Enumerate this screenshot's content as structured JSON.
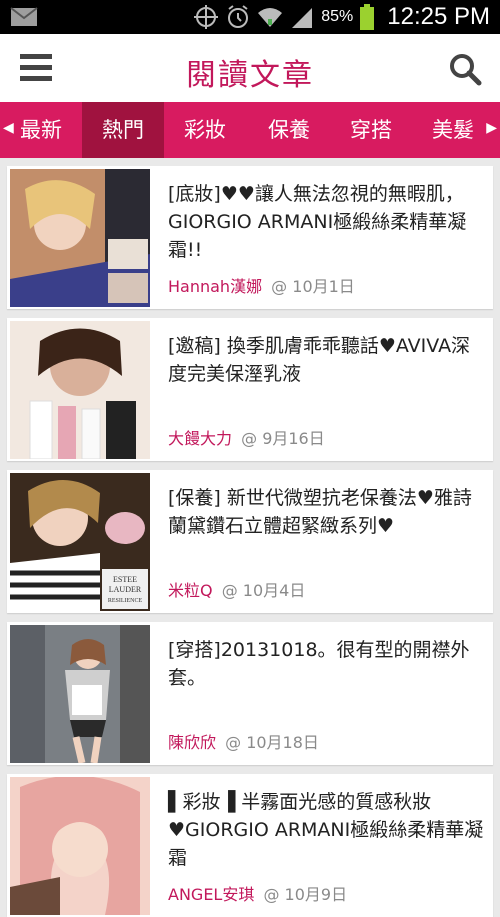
{
  "status_bar": {
    "battery_percent": "85%",
    "time": "12:25 PM"
  },
  "header": {
    "title": "閱讀文章"
  },
  "tabs": [
    {
      "label": "最新",
      "active": false
    },
    {
      "label": "熱門",
      "active": true
    },
    {
      "label": "彩妝",
      "active": false
    },
    {
      "label": "保養",
      "active": false
    },
    {
      "label": "穿搭",
      "active": false
    },
    {
      "label": "美髮",
      "active": false
    }
  ],
  "articles": [
    {
      "title": "[底妝]♥♥讓人無法忽視的無暇肌，GIORGIO ARMANI極緞絲柔精華凝霜!!",
      "author": "Hannah漢娜",
      "date": "@ 10月1日",
      "thumb_colors": [
        "#c28e6a",
        "#2b2a33",
        "#e8c47a"
      ]
    },
    {
      "title": "[邀稿] 換季肌膚乖乖聽話♥AVIVA深度完美保溼乳液",
      "author": "大饅大力",
      "date": "@ 9月16日",
      "thumb_colors": [
        "#d9b09a",
        "#f2e8e0",
        "#e6a6b4"
      ]
    },
    {
      "title": "[保養] 新世代微塑抗老保養法♥雅詩蘭黛鑽石立體超緊緻系列♥",
      "author": "米粒Q",
      "date": "@ 10月4日",
      "thumb_colors": [
        "#3a2a1e",
        "#b28a4c",
        "#f0f0f0"
      ],
      "thumb_text": [
        "ESTEE",
        "LAUDER",
        "RESILIENCE"
      ]
    },
    {
      "title": "[穿搭]20131018。很有型的開襟外套。",
      "author": "陳欣欣",
      "date": "@ 10月18日",
      "thumb_colors": [
        "#7a7f84",
        "#cfcfcf",
        "#2a2a2a"
      ]
    },
    {
      "title": "▌彩妝▐ 半霧面光感的質感秋妝♥GIORGIO ARMANI極緞絲柔精華凝霜",
      "author": "ANGEL安琪",
      "date": "@ 10月9日",
      "thumb_colors": [
        "#e7a5a0",
        "#f4d3c9",
        "#6b4a3a"
      ]
    }
  ]
}
